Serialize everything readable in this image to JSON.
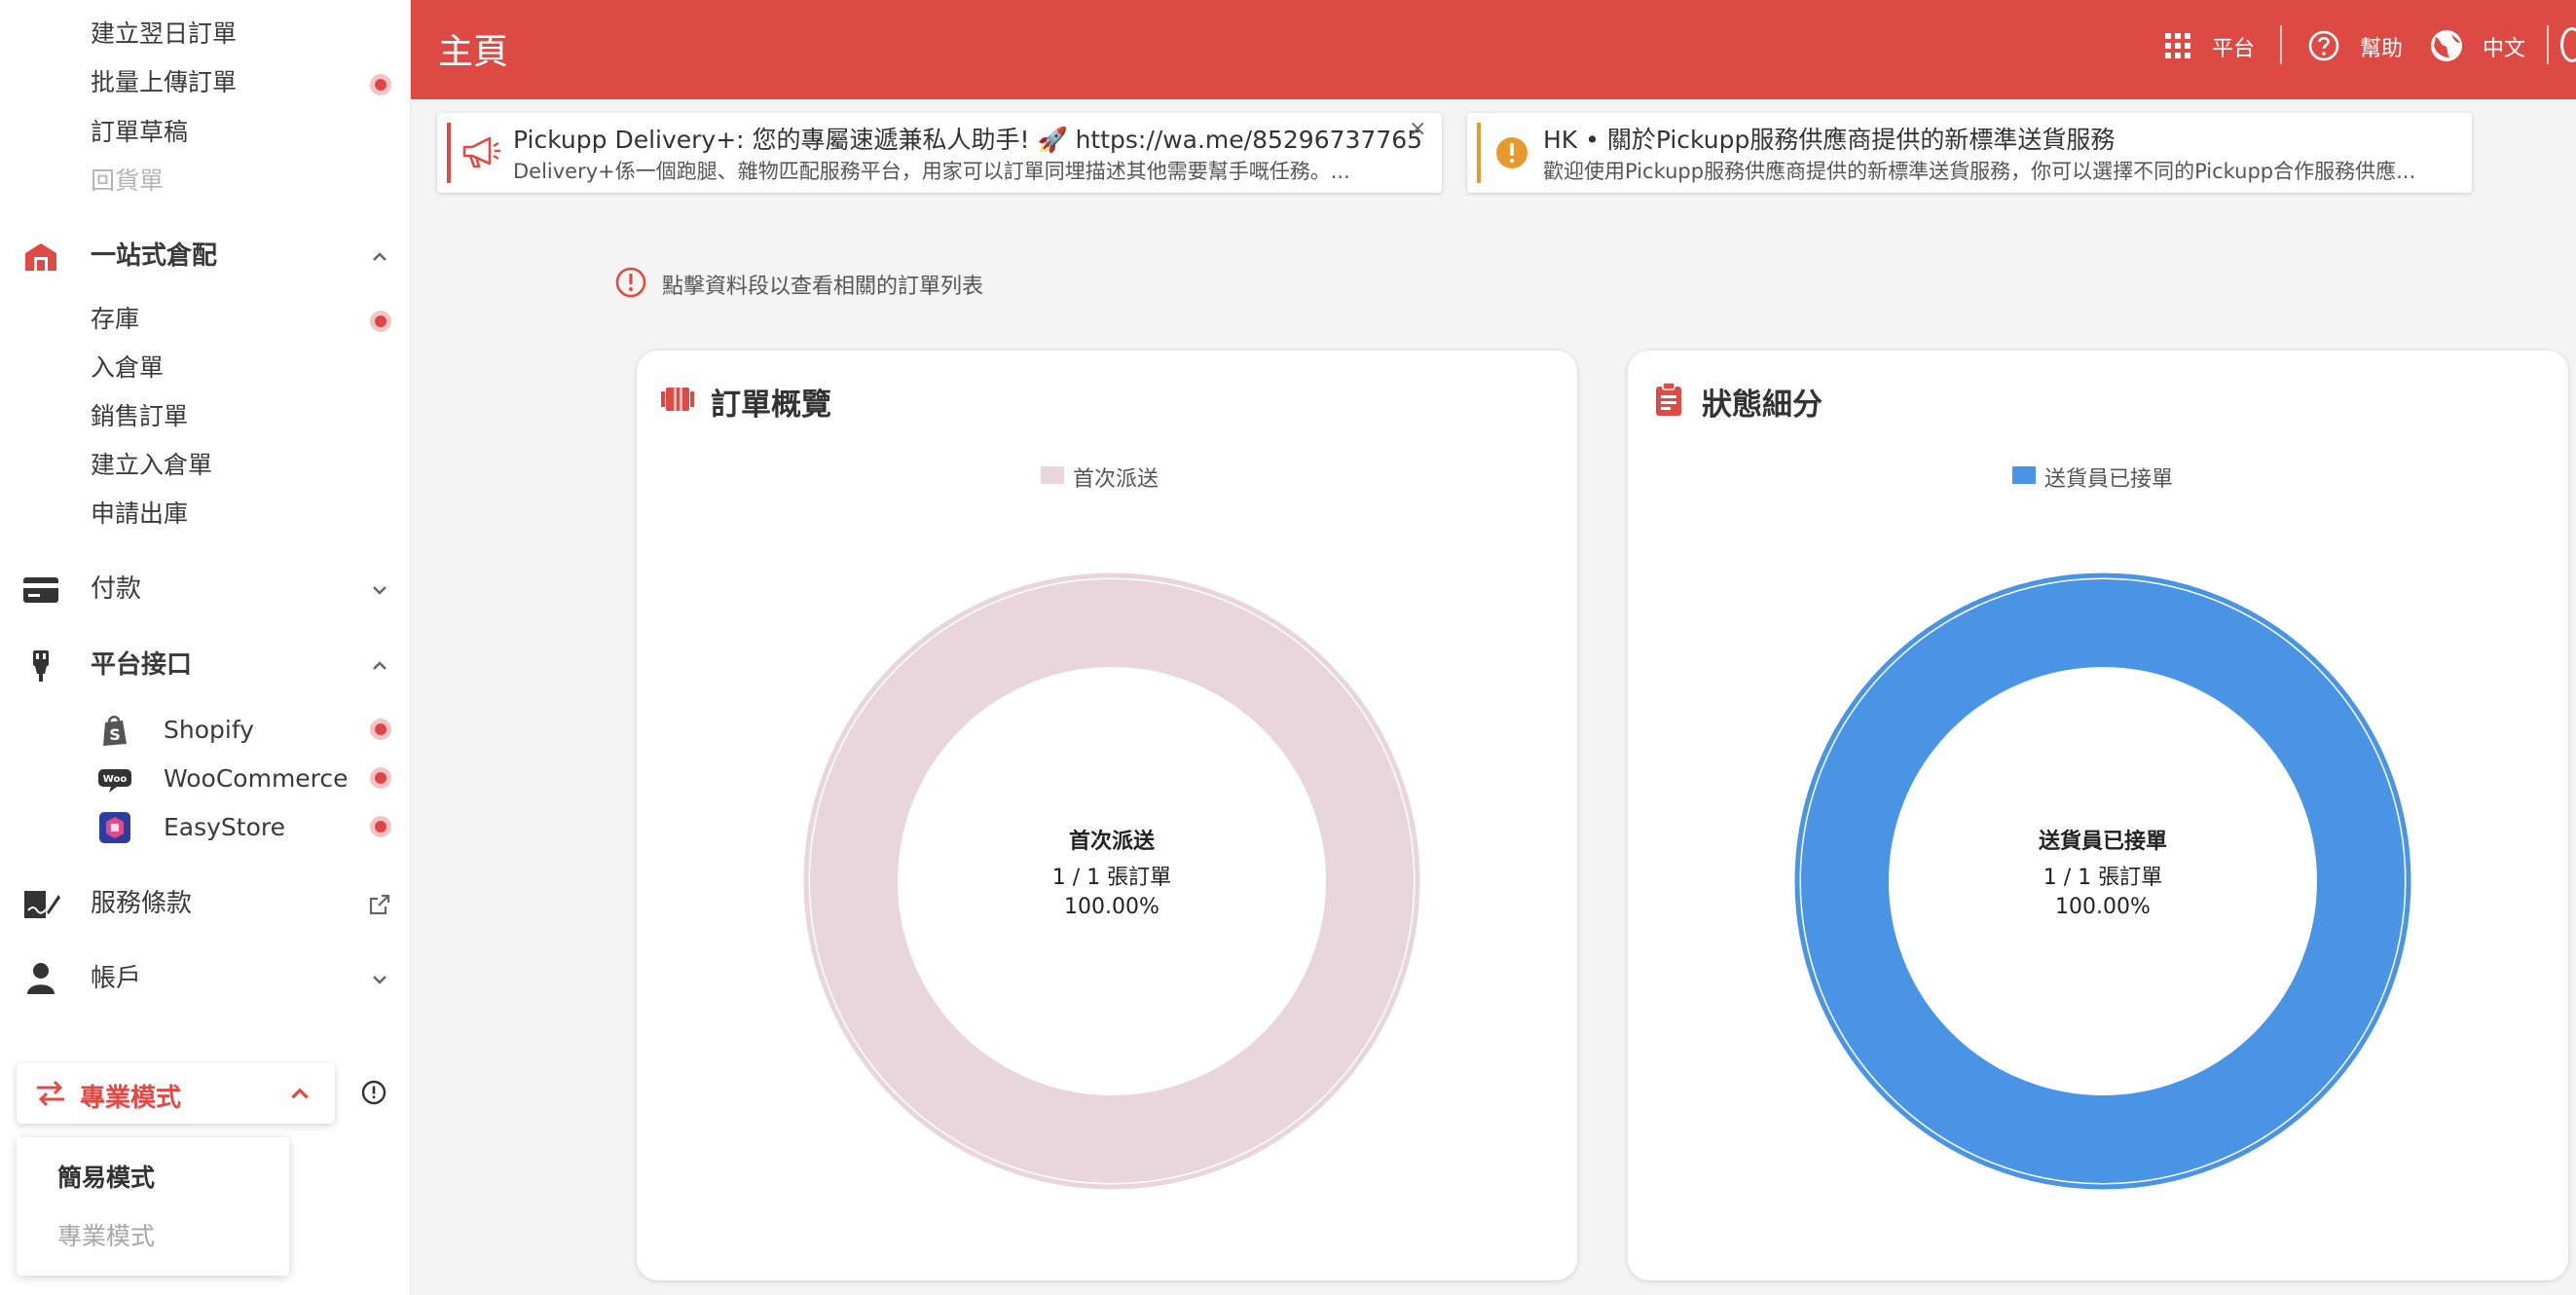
{
  "sidebar": {
    "top_items": [
      {
        "label": "建立翌日訂單",
        "dot": false,
        "disabled": false
      },
      {
        "label": "批量上傳訂單",
        "dot": true,
        "disabled": false
      },
      {
        "label": "訂單草稿",
        "dot": false,
        "disabled": false
      },
      {
        "label": "回貨單",
        "dot": false,
        "disabled": true
      }
    ],
    "warehouse": {
      "label": "一站式倉配",
      "items": [
        {
          "label": "存庫",
          "dot": true
        },
        {
          "label": "入倉單",
          "dot": false
        },
        {
          "label": "銷售訂單",
          "dot": false
        },
        {
          "label": "建立入倉單",
          "dot": false
        },
        {
          "label": "申請出庫",
          "dot": false
        }
      ]
    },
    "payment": {
      "label": "付款"
    },
    "platform": {
      "label": "平台接口",
      "items": [
        {
          "label": "Shopify",
          "icon": "shopify-logo"
        },
        {
          "label": "WooCommerce",
          "icon": "woocommerce-logo"
        },
        {
          "label": "EasyStore",
          "icon": "easystore-logo"
        }
      ]
    },
    "terms": {
      "label": "服務條款"
    },
    "account": {
      "label": "帳戶"
    },
    "mode": {
      "current": "專業模式",
      "options": [
        "簡易模式",
        "專業模式"
      ]
    }
  },
  "header": {
    "title": "主頁",
    "platform_label": "平台",
    "help_label": "幫助",
    "language_label": "中文"
  },
  "notices": [
    {
      "title": "Pickupp Delivery+: 您的專屬速遞兼私人助手! 🚀 https://wa.me/85296737765",
      "body": "Delivery+係一個跑腿、雜物匹配服務平台，用家可以訂單同埋描述其他需要幫手嘅任務。...",
      "close": "×",
      "icon": "megaphone-icon",
      "accent": "#e04a45"
    },
    {
      "title": "HK • 關於Pickupp服務供應商提供的新標準送貨服務",
      "body": "歡迎使用Pickupp服務供應商提供的新標準送貨服務，你可以選擇不同的Pickupp合作服務供應...",
      "icon": "warning-icon",
      "accent": "#e69a2e"
    }
  ],
  "hint": "點擊資料段以查看相關的訂單列表",
  "chart_data": [
    {
      "type": "pie",
      "title": "訂單概覽",
      "categories": [
        "首次派送"
      ],
      "values": [
        1
      ],
      "colors": [
        "#e8d6dc"
      ],
      "center": {
        "label": "首次派送",
        "count": "1 / 1 張訂單",
        "percent": "100.00%"
      }
    },
    {
      "type": "pie",
      "title": "狀態細分",
      "categories": [
        "送貨員已接單"
      ],
      "values": [
        1
      ],
      "colors": [
        "#4a94e6"
      ],
      "center": {
        "label": "送貨員已接單",
        "count": "1 / 1 張訂單",
        "percent": "100.00%"
      }
    }
  ]
}
